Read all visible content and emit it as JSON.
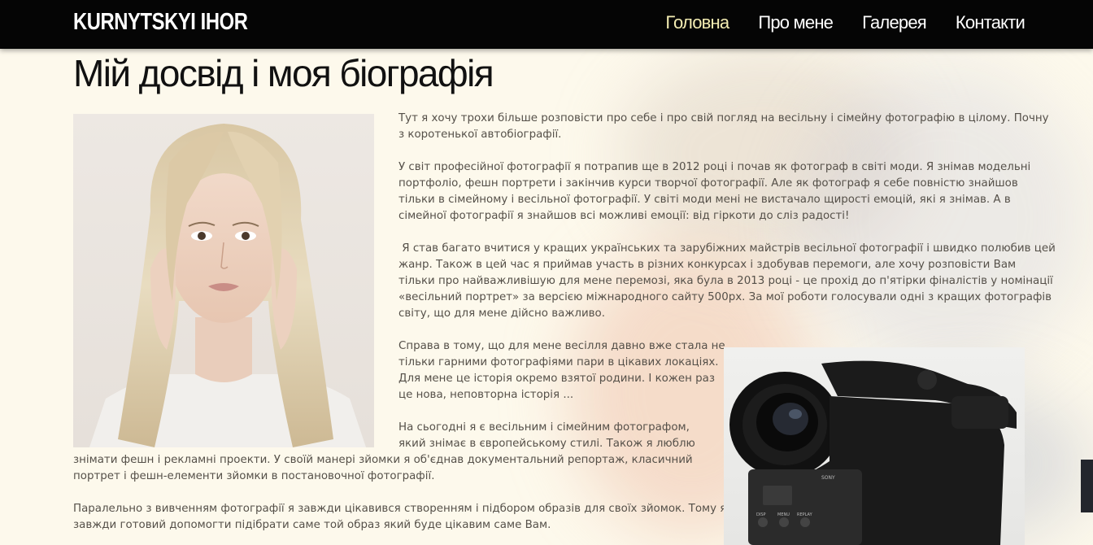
{
  "brand": "KURNYTSKYI IHOR",
  "nav": [
    {
      "label": "Головна",
      "active": true
    },
    {
      "label": "Про мене",
      "active": false
    },
    {
      "label": "Галерея",
      "active": false
    },
    {
      "label": "Контакти",
      "active": false
    }
  ],
  "page_title": "Мій досвід і моя біографія",
  "paragraphs": {
    "p1": [
      "Тут я хочу трохи більше розповісти про себе і про свій погляд на весільну і сімейну фотографію в цілому. Почну",
      "з коротенької автобіографії."
    ],
    "p2": [
      "У світ професійної фотографії я потрапив ще в 2012 році і почав як фотограф в світі моди. Я знімав модельні",
      "портфоліо, фешн портрети і закінчив курси творчої фотографії. Але як фотограф я себе повністю знайшов",
      "тільки в сімейному і весільної фотографії. У світі моди мені не вистачало щирості емоцій, які я знімав. А в",
      "сімейної фотографії я знайшов всі можливі емоції: від гіркоти до сліз радості!"
    ],
    "p3": [
      " Я став багато вчитися у кращих українських та зарубіжних майстрів весільної фотографії і швидко полюбив цей",
      "жанр. Також в цей час я приймав участь в різних конкурсах і здобував перемоги, але хочу розповісти Вам",
      "тільки про найважливішую для мене перемозі, яка була в 2013 році - це прохід до п'ятірки фіналістів у номінації",
      "«весільний портрет» за версією міжнародного сайту 500px. За мої роботи голосували одні з кращих фотографів",
      "світу, що для мене дійсно важливо."
    ],
    "p4": [
      "Справа в тому, що для мене весілля давно вже стала не",
      "тільки гарними фотографіями пари в цікавих локаціях.",
      "Для мене це історія окремо взятої родини. І кожен раз",
      "це нова, неповторна історія ..."
    ],
    "p5a": [
      "На сьогодні я є весільним і сімейним фотографом,",
      "який знімає в європейському стилі. Також я люблю"
    ],
    "p5b": [
      "знімати фешн і рекламні проекти. У своїй манері зйомки я об'єднав документальний репортаж, класичний",
      "портрет і фешн-елементи зйомки в постановочної фотографії."
    ],
    "p6": [
      "Паралельно з вивченням фотографії я завжди цікавився створенням і підбором образів для своїх зйомок. Тому я",
      "завжди готовий допомогти підібрати саме той образ який буде цікавим саме Вам."
    ]
  },
  "camera_labels": {
    "brand": "SONY",
    "buttons": [
      "DISP",
      "MENU",
      "REPLAY"
    ]
  },
  "colors": {
    "navbar": "#050505",
    "nav_active": "#f3ecb2",
    "background": "#fdf9ec",
    "body_text": "#555049",
    "title": "#111111"
  }
}
